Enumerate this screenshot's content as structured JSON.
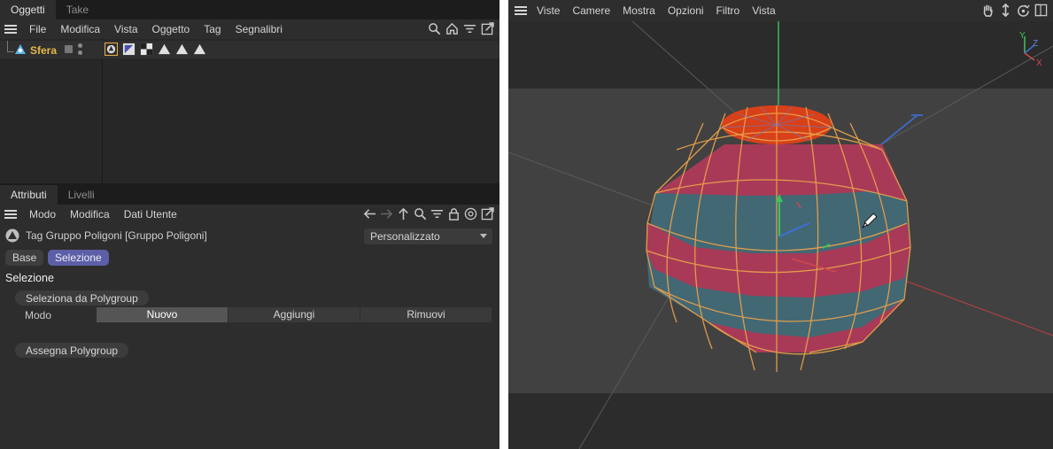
{
  "objects_panel": {
    "tabs": [
      {
        "label": "Oggetti"
      },
      {
        "label": "Take"
      }
    ],
    "menu": [
      {
        "label": "File"
      },
      {
        "label": "Modifica"
      },
      {
        "label": "Vista"
      },
      {
        "label": "Oggetto"
      },
      {
        "label": "Tag"
      },
      {
        "label": "Segnalibri"
      }
    ],
    "toolbar_icons": [
      "search-icon",
      "home-icon",
      "filter-icon",
      "popout-icon"
    ],
    "object": {
      "name": "Sfera",
      "color": "#e8b84a"
    },
    "tag_icons": [
      "phong-tag-icon",
      "selection-tag-icon",
      "texture-tag-icon",
      "polygon-selection-tag-icon",
      "polygon-selection-tag-icon",
      "polygon-selection-tag-icon"
    ]
  },
  "attributes_panel": {
    "tabs": [
      {
        "label": "Attributi"
      },
      {
        "label": "Livelli"
      }
    ],
    "menu": [
      {
        "label": "Modo"
      },
      {
        "label": "Modifica"
      },
      {
        "label": "Dati Utente"
      }
    ],
    "nav_icons": [
      "back-arrow-icon",
      "forward-arrow-icon",
      "up-arrow-icon",
      "search-icon",
      "filter-icon",
      "lock-icon",
      "target-icon",
      "popout-icon"
    ],
    "tag_title": "Tag Gruppo Poligoni [Gruppo Poligoni]",
    "preset_dropdown": "Personalizzato",
    "subtabs": {
      "base": "Base",
      "selection": "Selezione"
    },
    "section_title": "Selezione",
    "select_button": "Seleziona da Polygroup",
    "mode_label": "Modo",
    "mode_options": [
      {
        "label": "Nuovo"
      },
      {
        "label": "Aggiungi"
      },
      {
        "label": "Rimuovi"
      }
    ],
    "mode_selected": "Nuovo",
    "assign_button": "Assegna Polygroup"
  },
  "viewport": {
    "menu": [
      {
        "label": "Viste"
      },
      {
        "label": "Camere"
      },
      {
        "label": "Mostra"
      },
      {
        "label": "Opzioni"
      },
      {
        "label": "Filtro"
      },
      {
        "label": "Vista"
      }
    ],
    "nav_icons": [
      "pan-hand-icon",
      "move-icon",
      "rotate-icon",
      "maximize-icon"
    ],
    "axis_labels": {
      "x": "X",
      "y": "Y",
      "z": "Z"
    },
    "colors": {
      "pink": "#a83a58",
      "teal": "#426874",
      "top_cap": "#d8401a",
      "edge": "#e8a04a",
      "x_axis": "#c94848",
      "y_axis": "#3ec45a",
      "z_axis": "#3d6fd6",
      "accent": "#5c5fa8"
    }
  }
}
